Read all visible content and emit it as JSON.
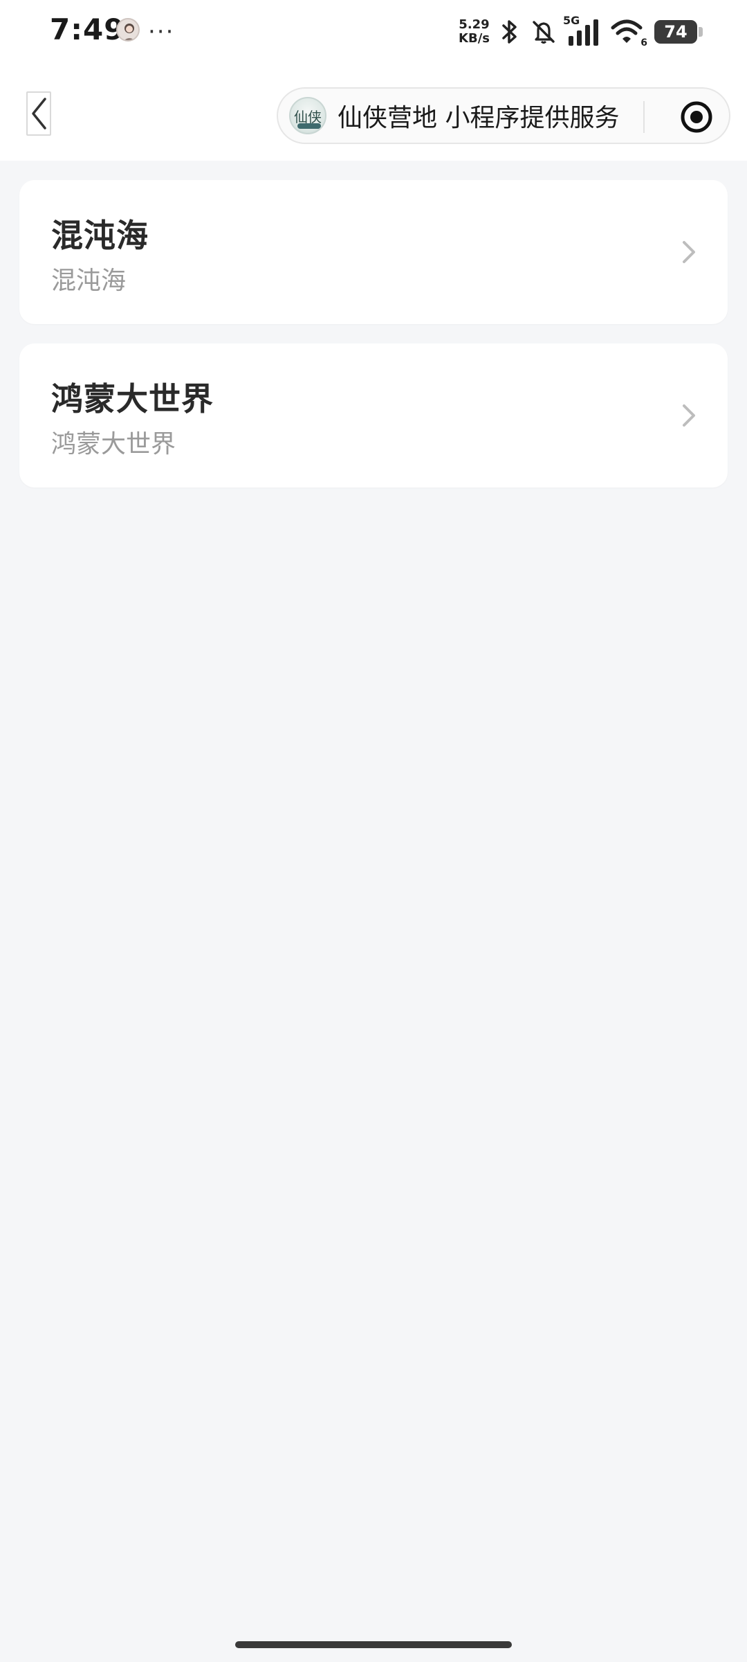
{
  "status_bar": {
    "time": "7:49",
    "more": "···",
    "net_speed_value": "5.29",
    "net_speed_unit": "KB/s",
    "signal_label": "5G",
    "wifi_sub": "6",
    "battery": "74",
    "icons": [
      "bluetooth-icon",
      "bell-off-icon",
      "signal-icon",
      "wifi-icon",
      "battery-icon"
    ]
  },
  "nav": {
    "back_icon": "chevron-left-icon",
    "app_logo_text": "仙侠",
    "capsule_title": "仙侠营地 小程序提供服务",
    "capsule_action_icon": "target-icon"
  },
  "list": {
    "items": [
      {
        "title": "混沌海",
        "subtitle": "混沌海"
      },
      {
        "title": "鸿蒙大世界",
        "subtitle": "鸿蒙大世界"
      }
    ],
    "chevron_icon": "chevron-right-icon"
  },
  "colors": {
    "background": "#f5f6f8",
    "card": "#ffffff",
    "title_text": "#2a2a2a",
    "subtitle_text": "#9a9a9a"
  }
}
